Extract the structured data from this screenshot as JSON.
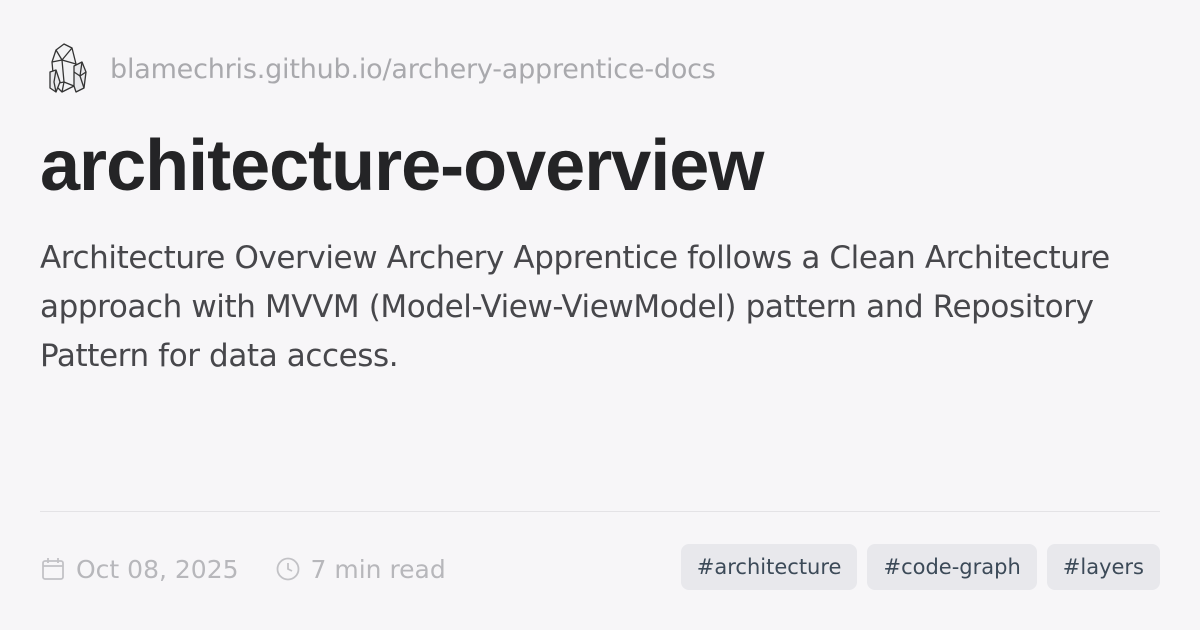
{
  "site": {
    "url": "blamechris.github.io/archery-apprentice-docs",
    "logo_icon": "crystal-logo-icon"
  },
  "page": {
    "title": "architecture-overview",
    "description": "Architecture Overview Archery Apprentice follows a Clean Architecture approach with MVVM (Model-View-ViewModel) pattern and Repository Pattern for data access."
  },
  "meta": {
    "date": "Oct 08, 2025",
    "date_icon": "calendar-icon",
    "read_time": "7 min read",
    "read_time_icon": "clock-icon"
  },
  "tags": [
    "#architecture",
    "#code-graph",
    "#layers"
  ],
  "colors": {
    "background": "#f7f6f8",
    "title": "#242426",
    "muted": "#b7b7bb",
    "tag_bg": "#e8e8ec",
    "tag_text": "#3c4a58"
  }
}
